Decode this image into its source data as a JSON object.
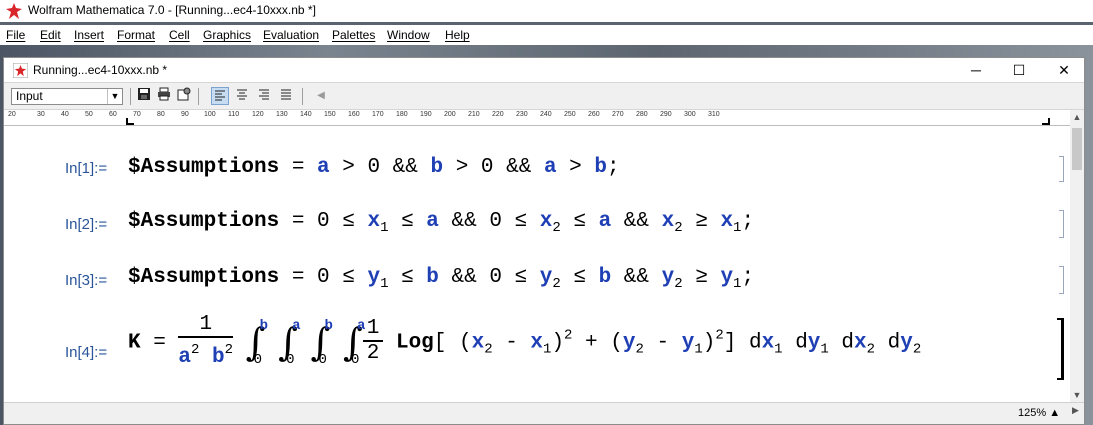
{
  "app": {
    "title": "Wolfram Mathematica 7.0 - [Running...ec4-10xxx.nb *]"
  },
  "menu": [
    "File",
    "Edit",
    "Insert",
    "Format",
    "Cell",
    "Graphics",
    "Evaluation",
    "Palettes",
    "Window",
    "Help"
  ],
  "notebook": {
    "title": "Running...ec4-10xxx.nb *"
  },
  "window_buttons": {
    "minimize": "─",
    "maximize": "☐",
    "close": "✕"
  },
  "toolbar": {
    "style_value": "Input"
  },
  "ruler": [
    "20",
    "30",
    "40",
    "50",
    "60",
    "70",
    "80",
    "90",
    "100",
    "110",
    "120",
    "130",
    "140",
    "150",
    "160",
    "170",
    "180",
    "190",
    "200",
    "210",
    "220",
    "230",
    "240",
    "250",
    "260",
    "270",
    "280",
    "290",
    "300",
    "310"
  ],
  "cells": [
    {
      "label": "In[1]:="
    },
    {
      "label": "In[2]:="
    },
    {
      "label": "In[3]:="
    },
    {
      "label": "In[4]:="
    }
  ],
  "expr": {
    "assume": "$Assumptions",
    "a": "a",
    "b": "b",
    "x": "x",
    "y": "y",
    "K": "K",
    "one": "1",
    "two": "2",
    "zero": "0",
    "d": "d",
    "log": "Log"
  },
  "status": {
    "zoom": "125%"
  }
}
